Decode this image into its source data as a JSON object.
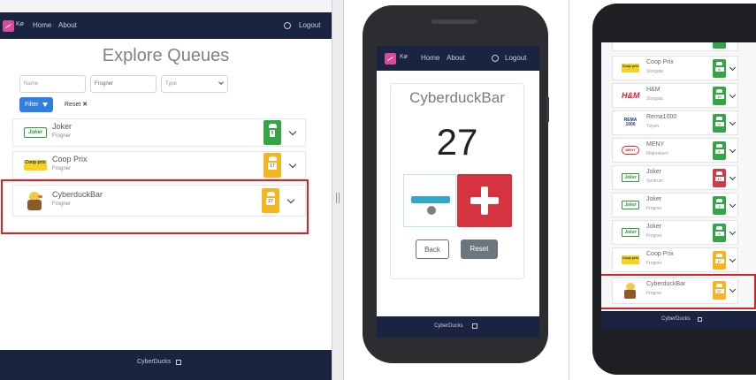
{
  "desktop": {
    "nav": {
      "brand": "Kø",
      "home": "Home",
      "about": "About",
      "logout": "Logout"
    },
    "title": "Explore Queues",
    "filters": {
      "name_placeholder": "Name",
      "location_value": "Frogner",
      "type_value": "Type",
      "filter_label": "Filter",
      "reset_label": "Reset"
    },
    "queues": [
      {
        "name": "Joker",
        "location": "Frogner",
        "count": "5",
        "status": "green",
        "logo": "joker",
        "logo_text": "Joker"
      },
      {
        "name": "Coop Prix",
        "location": "Frogner",
        "count": "17",
        "status": "yellow",
        "logo": "coop",
        "logo_text": "Coop prix"
      },
      {
        "name": "CyberduckBar",
        "location": "Frogner",
        "count": "27",
        "status": "yellow",
        "logo": "duck",
        "logo_text": ""
      }
    ],
    "footer": "CyberDucks"
  },
  "phone_middle": {
    "nav": {
      "brand": "Kø",
      "home": "Home",
      "about": "About",
      "logout": "Logout"
    },
    "queue_name": "CyberduckBar",
    "count": "27",
    "back_label": "Back",
    "reset_label": "Reset",
    "footer": "CyberDucks"
  },
  "phone_right": {
    "queues": [
      {
        "name": "",
        "location": "",
        "count": "",
        "status": "green",
        "logo": "none",
        "logo_text": ""
      },
      {
        "name": "Coop Prix",
        "location": "Storgata",
        "count": "5",
        "status": "green",
        "logo": "coop",
        "logo_text": "Coop prix"
      },
      {
        "name": "H&M",
        "location": "Storgata",
        "count": "10",
        "status": "green",
        "logo": "hm",
        "logo_text": "H&M"
      },
      {
        "name": "Rema1000",
        "location": "Tøyen",
        "count": "9",
        "status": "green",
        "logo": "rema",
        "logo_text": "REMA 1000"
      },
      {
        "name": "MENY",
        "location": "Majorstuen",
        "count": "5",
        "status": "green",
        "logo": "meny",
        "logo_text": "MENY"
      },
      {
        "name": "Joker",
        "location": "Sentrum",
        "count": "42",
        "status": "red",
        "logo": "joker",
        "logo_text": "Joker"
      },
      {
        "name": "Joker",
        "location": "Frogner",
        "count": "3",
        "status": "green",
        "logo": "joker",
        "logo_text": "Joker"
      },
      {
        "name": "Joker",
        "location": "Frogner",
        "count": "5",
        "status": "green",
        "logo": "joker",
        "logo_text": "Joker"
      },
      {
        "name": "Coop Prix",
        "location": "Frogner",
        "count": "17",
        "status": "yellow",
        "logo": "coop",
        "logo_text": "Coop prix"
      },
      {
        "name": "CyberduckBar",
        "location": "Frogner",
        "count": "27",
        "status": "yellow",
        "logo": "duck",
        "logo_text": ""
      }
    ],
    "footer": "CyberDucks"
  },
  "colors": {
    "nav": "#1a2340",
    "green": "#34a545",
    "yellow": "#f3b61f",
    "red": "#d13a45",
    "highlight": "#d82027",
    "filter": "#2f7fe0"
  },
  "icons": [
    "logo-icon",
    "user-icon",
    "filter-icon",
    "close-icon",
    "people-icon",
    "chevron-down-icon",
    "plus-icon",
    "minus-icon"
  ]
}
